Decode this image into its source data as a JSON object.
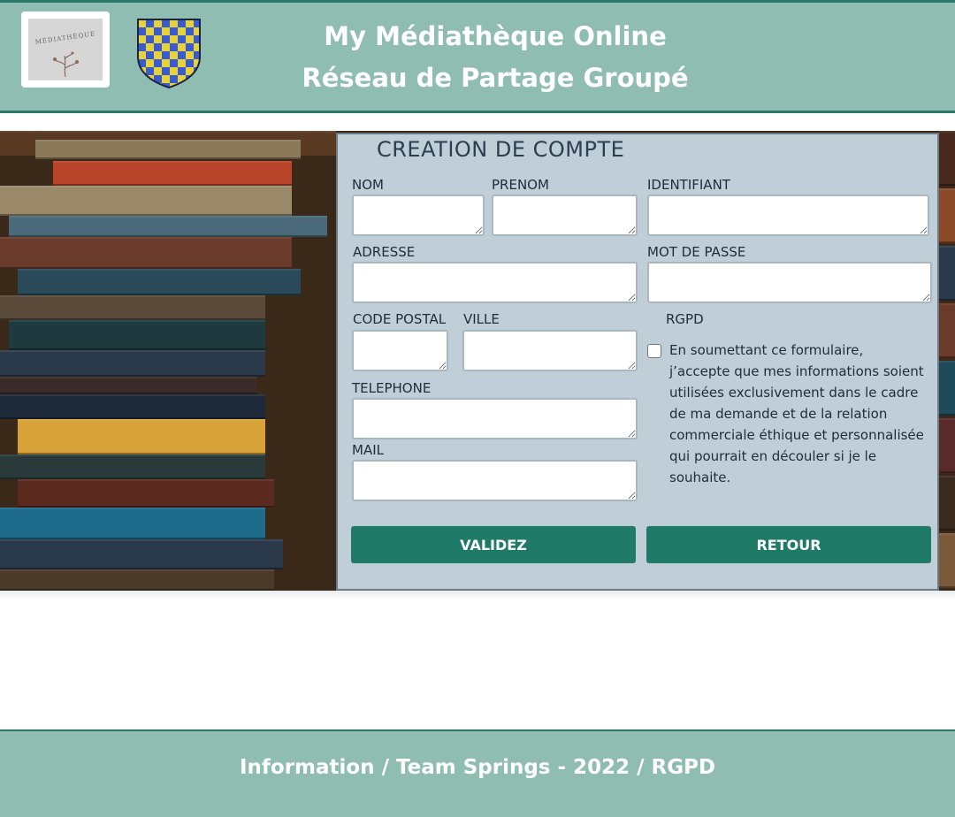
{
  "header": {
    "logo_text": "MÉDIATHÈQUE",
    "title_line1": "My Médiathèque Online",
    "title_line2": "Réseau de Partage Groupé"
  },
  "form": {
    "title": "CREATION DE COMPTE",
    "labels": {
      "nom": "NOM",
      "prenom": "PRENOM",
      "identifiant": "IDENTIFIANT",
      "adresse": "ADRESSE",
      "mot_de_passe": "MOT DE PASSE",
      "code_postal": "CODE POSTAL",
      "ville": "VILLE",
      "rgpd": "RGPD",
      "telephone": "TELEPHONE",
      "mail": "MAIL"
    },
    "values": {
      "nom": "",
      "prenom": "",
      "identifiant": "",
      "adresse": "",
      "mot_de_passe": "",
      "code_postal": "",
      "ville": "",
      "telephone": "",
      "mail": ""
    },
    "rgpd_consent_text": "En soumettant ce formulaire, j’accepte que mes informations soient utilisées exclusivement dans le cadre de ma demande et de la relation commerciale éthique et personnalisée qui pourrait en découler si je le souhaite.",
    "rgpd_checked": false,
    "validate_label": "VALIDEZ",
    "back_label": "RETOUR"
  },
  "footer": {
    "text": "Information / Team Springs - 2022 / RGPD"
  },
  "colors": {
    "header_bg": "#8fbdb2",
    "accent": "#2a7a6a",
    "button": "#1f7a68",
    "panel": "#c0ced7"
  }
}
